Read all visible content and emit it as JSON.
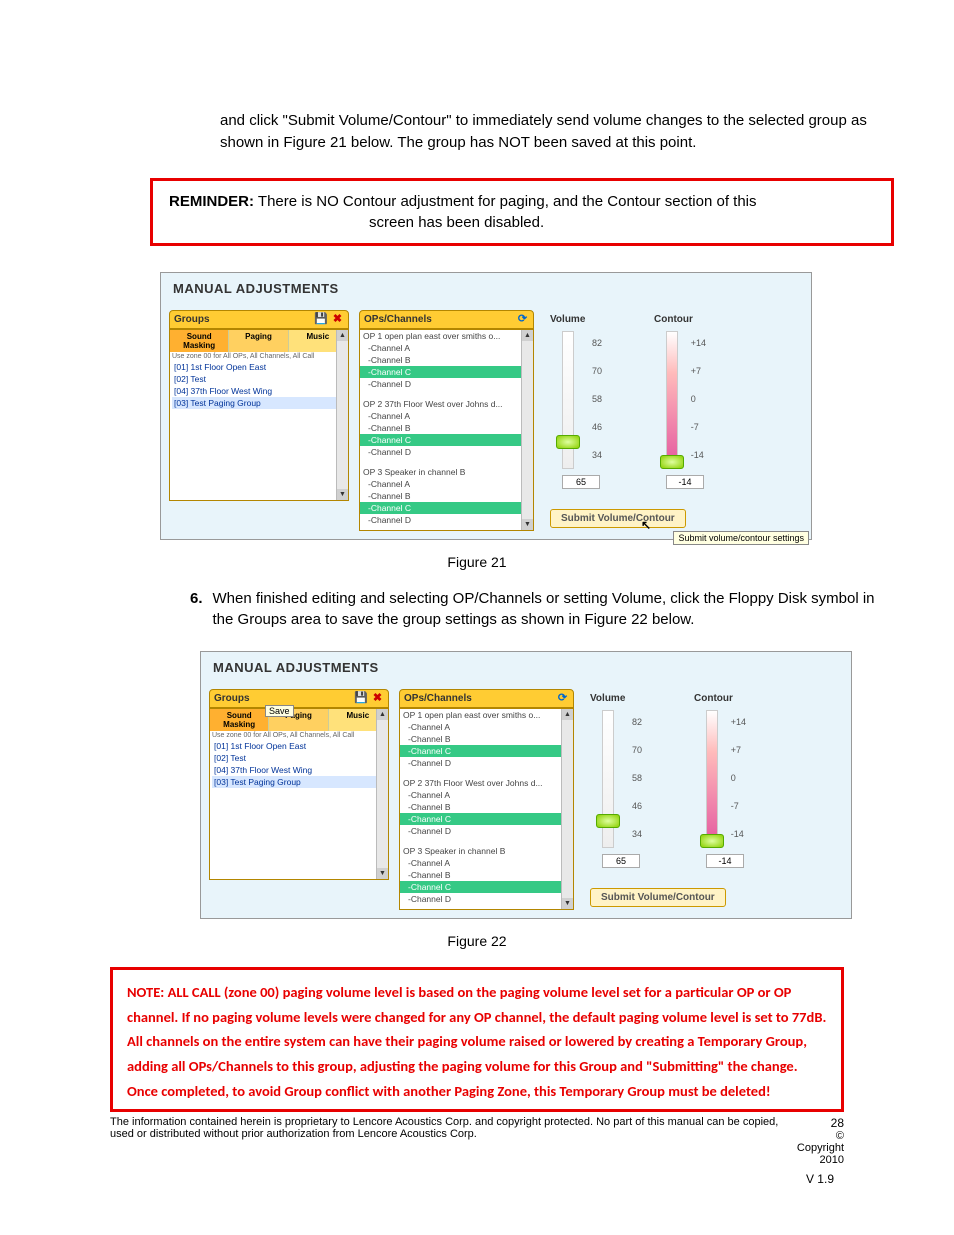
{
  "intro": "and click \"Submit Volume/Contour\" to immediately send volume changes to the selected group as shown in Figure 21 below.   The group has NOT been saved at this point.",
  "reminder": {
    "label": "REMINDER:",
    "line1": "There is NO Contour adjustment for paging, and the Contour section of this",
    "line2": "screen has been disabled."
  },
  "figure21": {
    "caption": "Figure 21",
    "app_title": "MANUAL ADJUSTMENTS",
    "groups": {
      "header": "Groups",
      "tabs": {
        "sm": "Sound Masking",
        "pg": "Paging",
        "mu": "Music"
      },
      "hint": "Use zone 00 for All OPs, All Channels, All Call",
      "items": [
        "[01] 1st Floor Open East",
        "[02] Test",
        "[04] 37th Floor West Wing",
        "[03] Test Paging Group"
      ]
    },
    "ops": {
      "header": "OPs/Channels",
      "list": [
        {
          "t": "OP 1 open plan east over smiths o...",
          "cls": ""
        },
        {
          "t": "-Channel A",
          "cls": "ch"
        },
        {
          "t": "-Channel B",
          "cls": "ch"
        },
        {
          "t": "-Channel C",
          "cls": "ch selc"
        },
        {
          "t": "-Channel D",
          "cls": "ch"
        },
        {
          "t": "",
          "cls": "gap"
        },
        {
          "t": "OP 2 37th Floor West over Johns d...",
          "cls": ""
        },
        {
          "t": "-Channel A",
          "cls": "ch"
        },
        {
          "t": "-Channel B",
          "cls": "ch"
        },
        {
          "t": "-Channel C",
          "cls": "ch selc"
        },
        {
          "t": "-Channel D",
          "cls": "ch"
        },
        {
          "t": "",
          "cls": "gap"
        },
        {
          "t": "OP 3 Speaker in channel B",
          "cls": ""
        },
        {
          "t": "-Channel A",
          "cls": "ch"
        },
        {
          "t": "-Channel B",
          "cls": "ch"
        },
        {
          "t": "-Channel C",
          "cls": "ch selc"
        },
        {
          "t": "-Channel D",
          "cls": "ch"
        }
      ]
    },
    "volume": {
      "label": "Volume",
      "ticks": [
        "82",
        "70",
        "58",
        "46",
        "34"
      ],
      "value": "65"
    },
    "contour": {
      "label": "Contour",
      "ticks": [
        "+14",
        "+7",
        "0",
        "-7",
        "-14"
      ],
      "value": "-14"
    },
    "submit": "Submit Volume/Contour",
    "tooltip": "Submit volume/contour settings"
  },
  "step6": {
    "num": "6.",
    "text": "When finished editing and selecting OP/Channels or setting Volume, click the Floppy Disk symbol in the Groups area to save the group settings as shown in Figure 22 below."
  },
  "figure22": {
    "caption": "Figure 22",
    "save_tip": "Save"
  },
  "note": "NOTE:  ALL CALL (zone 00) paging volume level is based on the paging volume level set for a particular OP or OP channel.  If no paging volume levels were changed for any OP channel, the default paging volume level is set to 77dB.  All channels on the entire system can have their paging volume raised or lowered by creating a Temporary Group, adding all OPs/Channels to this group, adjusting the paging volume for this Group and \"Submitting\" the change.  Once completed, to avoid Group conflict with another Paging Zone, this Temporary Group must be deleted!",
  "footer": {
    "text": "The information contained herein is proprietary to Lencore Acoustics Corp. and copyright protected. No part of this manual can be copied, used or distributed without prior authorization from Lencore Acoustics Corp.",
    "page": "28",
    "copyright": "© Copyright 2010",
    "version": "V 1.9"
  }
}
